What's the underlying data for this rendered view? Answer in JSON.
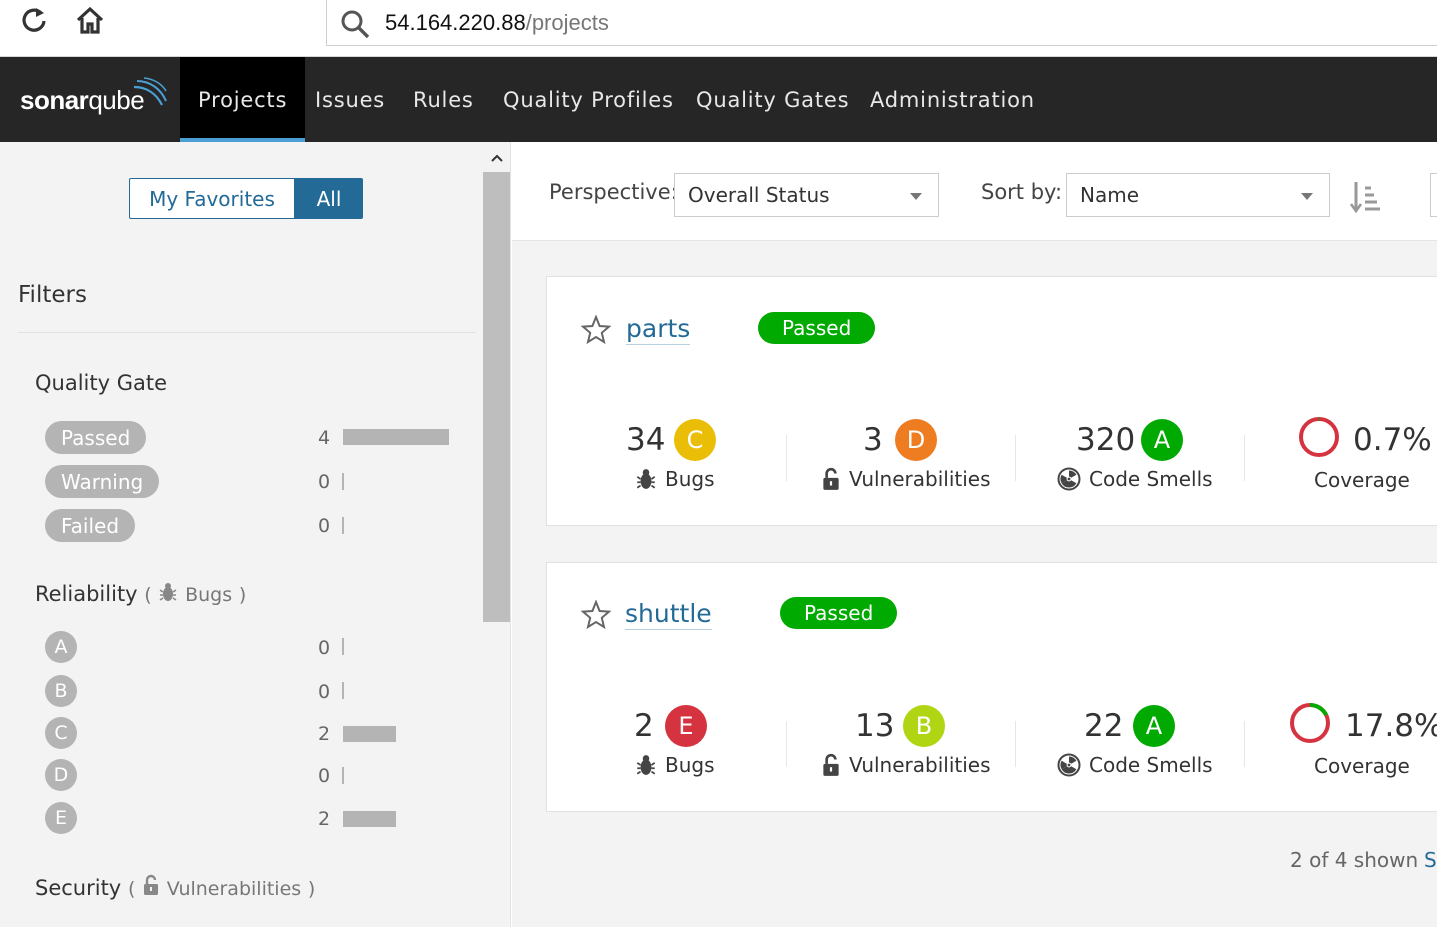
{
  "browser": {
    "url_host": "54.164.220.88",
    "url_path": "/projects"
  },
  "nav": {
    "logo_bold": "sonar",
    "logo_light": "qube",
    "items": [
      {
        "label": "Projects",
        "active": true
      },
      {
        "label": "Issues"
      },
      {
        "label": "Rules"
      },
      {
        "label": "Quality Profiles"
      },
      {
        "label": "Quality Gates"
      },
      {
        "label": "Administration"
      }
    ]
  },
  "sidebar": {
    "favorites_label": "My Favorites",
    "all_label": "All",
    "filters_title": "Filters",
    "quality_gate": {
      "title": "Quality Gate",
      "options": [
        {
          "label": "Passed",
          "count": "4",
          "fraction": 1.0
        },
        {
          "label": "Warning",
          "count": "0",
          "fraction": 0
        },
        {
          "label": "Failed",
          "count": "0",
          "fraction": 0
        }
      ]
    },
    "reliability": {
      "title": "Reliability",
      "paren_open": "(",
      "metric": "Bugs",
      "paren_close": ")",
      "options": [
        {
          "label": "A",
          "count": "0",
          "fraction": 0
        },
        {
          "label": "B",
          "count": "0",
          "fraction": 0
        },
        {
          "label": "C",
          "count": "2",
          "fraction": 0.5
        },
        {
          "label": "D",
          "count": "0",
          "fraction": 0
        },
        {
          "label": "E",
          "count": "2",
          "fraction": 0.5
        }
      ]
    },
    "security": {
      "title": "Security",
      "paren_open": "(",
      "metric": "Vulnerabilities",
      "paren_close": ")"
    }
  },
  "toolbar": {
    "perspective_label": "Perspective:",
    "perspective_value": "Overall Status",
    "sortby_label": "Sort by:",
    "sortby_value": "Name"
  },
  "projects": [
    {
      "name": "parts",
      "status": "Passed",
      "bugs": "34",
      "bugs_grade": "C",
      "vulns": "3",
      "vulns_grade": "D",
      "smells": "320",
      "smells_grade": "A",
      "coverage": "0.7%"
    },
    {
      "name": "shuttle",
      "status": "Passed",
      "bugs": "2",
      "bugs_grade": "E",
      "vulns": "13",
      "vulns_grade": "B",
      "smells": "22",
      "smells_grade": "A",
      "coverage": "17.8%"
    }
  ],
  "labels": {
    "bugs": "Bugs",
    "vulnerabilities": "Vulnerabilities",
    "code_smells": "Code Smells",
    "coverage": "Coverage"
  },
  "footer": {
    "shown": "2 of 4 shown",
    "more": "S"
  },
  "colors": {
    "grade_A": "#00aa00",
    "grade_B": "#b0d513",
    "grade_C": "#eabe06",
    "grade_D": "#ed7d20",
    "grade_E": "#d4333f",
    "passed": "#00aa00",
    "link": "#236a97"
  }
}
